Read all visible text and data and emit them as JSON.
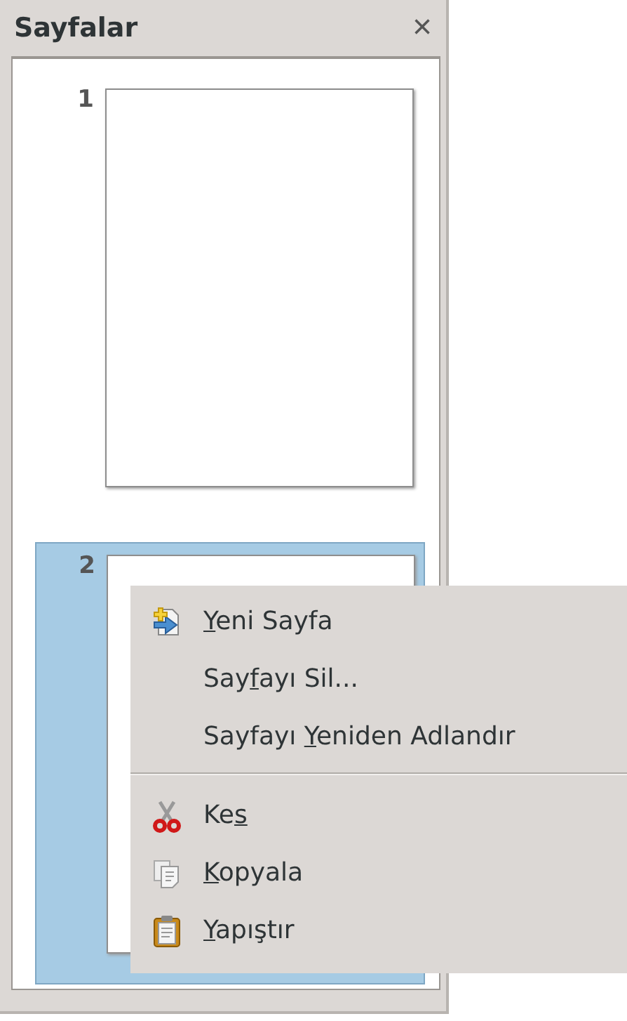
{
  "panel": {
    "title": "Sayfalar",
    "close": "×"
  },
  "pages": [
    {
      "number": "1",
      "selected": false
    },
    {
      "number": "2",
      "selected": true
    }
  ],
  "context_menu": [
    {
      "kind": "item",
      "key": "Y",
      "after": "eni Sayfa"
    },
    {
      "kind": "item",
      "before": "Say",
      "key": "f",
      "after": "ayı Sil..."
    },
    {
      "kind": "item",
      "before": "Sayfayı ",
      "key": "Y",
      "after": "eniden Adlandır"
    },
    {
      "kind": "separator"
    },
    {
      "kind": "item",
      "before": "Ke",
      "key": "s"
    },
    {
      "kind": "item",
      "key": "K",
      "after": "opyala"
    },
    {
      "kind": "item",
      "key": "Y",
      "after": "apıştır"
    }
  ]
}
